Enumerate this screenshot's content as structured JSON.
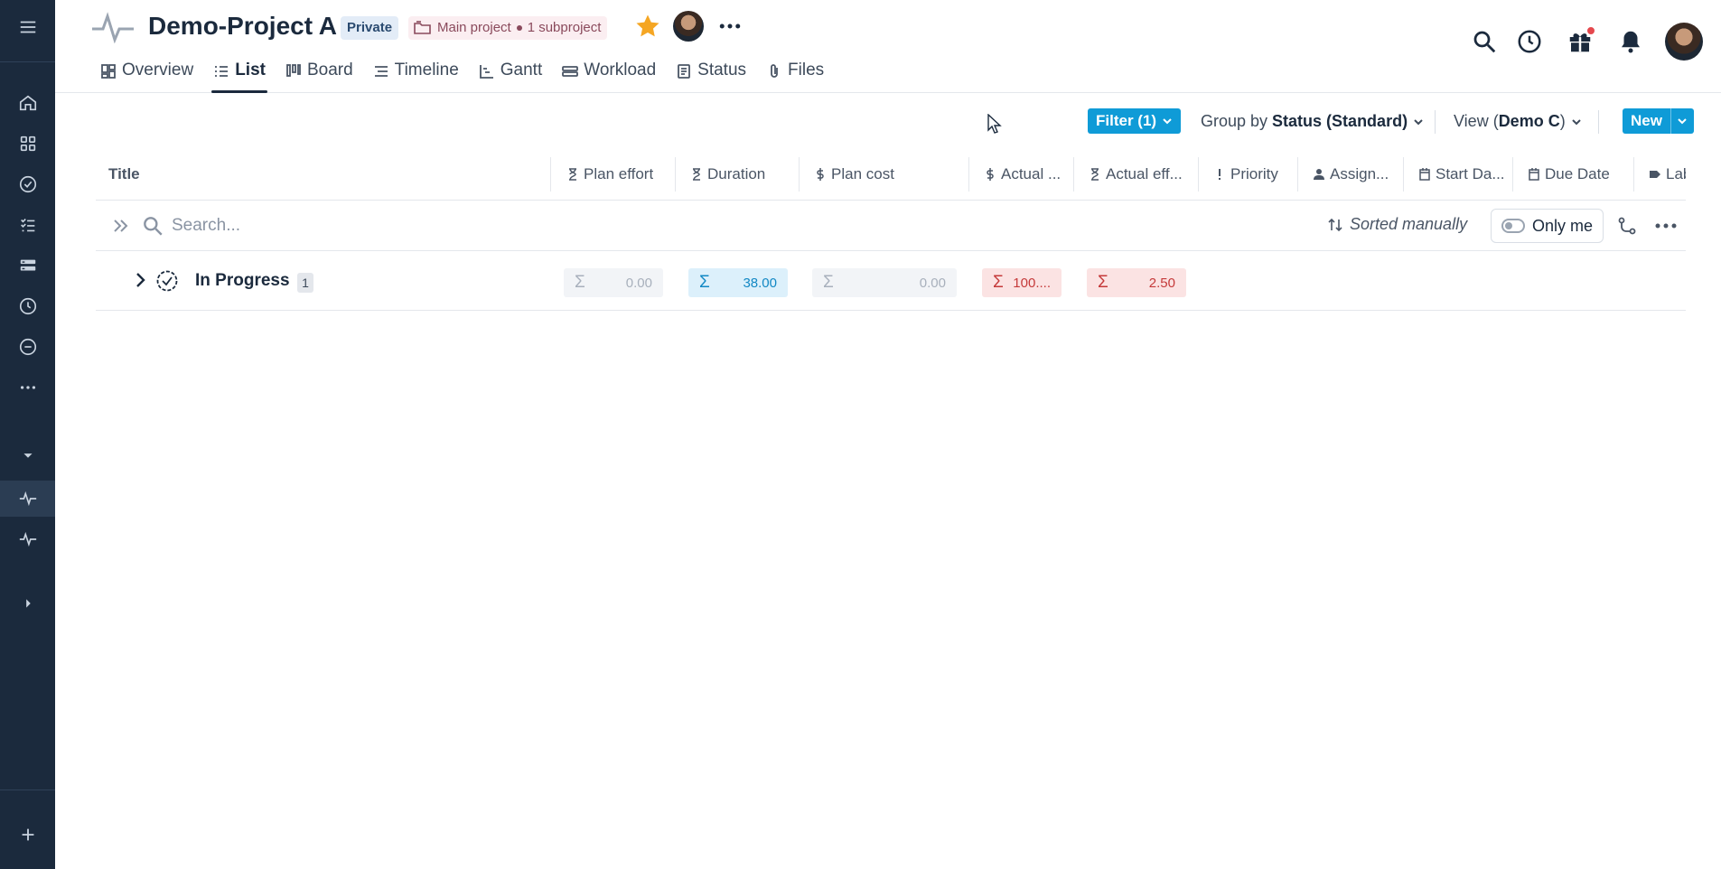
{
  "rail": {
    "items": [
      {
        "icon": "menu-icon"
      },
      {
        "icon": "home-icon"
      },
      {
        "icon": "apps-grid-icon"
      },
      {
        "icon": "check-circle-icon"
      },
      {
        "icon": "task-list-icon"
      },
      {
        "icon": "portfolio-icon"
      },
      {
        "icon": "clock-icon"
      },
      {
        "icon": "minus-circle-icon"
      },
      {
        "icon": "more-horizontal-icon"
      },
      {
        "icon": "caret-down-icon"
      },
      {
        "icon": "pulse-icon"
      },
      {
        "icon": "pulse-icon"
      },
      {
        "icon": "caret-right-icon"
      },
      {
        "icon": "plus-icon"
      }
    ]
  },
  "header": {
    "title": "Demo-Project A",
    "privacy": "Private",
    "main_project": "Main project",
    "subproject": "1 subproject",
    "tabs": [
      {
        "label": "Overview",
        "icon": "dashboard-icon"
      },
      {
        "label": "List",
        "icon": "list-icon",
        "active": true
      },
      {
        "label": "Board",
        "icon": "board-icon"
      },
      {
        "label": "Timeline",
        "icon": "timeline-icon"
      },
      {
        "label": "Gantt",
        "icon": "gantt-icon"
      },
      {
        "label": "Workload",
        "icon": "workload-icon"
      },
      {
        "label": "Status",
        "icon": "status-doc-icon"
      },
      {
        "label": "Files",
        "icon": "paperclip-icon"
      }
    ]
  },
  "toolbar": {
    "filter_label": "Filter (1)",
    "group_by_prefix": "Group by ",
    "group_by_value": "Status (Standard)",
    "view_prefix": "View (",
    "view_value": "Demo C",
    "view_suffix": ")",
    "new_label": "New"
  },
  "table": {
    "columns": {
      "title": "Title",
      "plan_effort": "Plan effort",
      "duration": "Duration",
      "plan_cost": "Plan cost",
      "actual_cost": "Actual ...",
      "actual_effort": "Actual eff...",
      "priority": "Priority",
      "assignee": "Assign...",
      "start_date": "Start Da...",
      "due_date": "Due Date",
      "labels": "Labe"
    },
    "search_placeholder": "Search...",
    "sorted_label": "Sorted manually",
    "only_me_label": "Only me",
    "group": {
      "name": "In Progress",
      "count": "1",
      "sigma": "Σ",
      "plan_effort": "0.00",
      "duration": "38.00",
      "plan_cost": "0.00",
      "actual_cost": "100....",
      "actual_effort": "2.50"
    }
  },
  "colors": {
    "rail_bg": "#1b2a3d",
    "accent": "#0f9bd7",
    "private_badge_bg": "#e3ecf7",
    "subproject_chip_bg": "#fbeef1",
    "star": "#f5a623",
    "over_budget": "#c53a3a"
  }
}
